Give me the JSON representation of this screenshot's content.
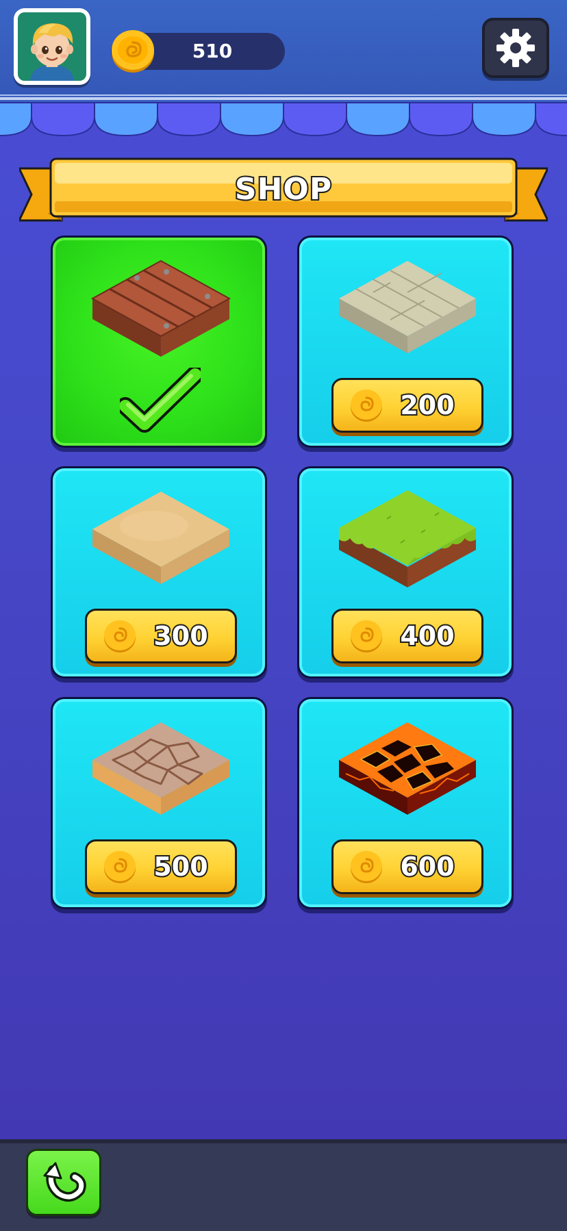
{
  "header": {
    "coins": "510",
    "avatar_icon": "boy-avatar-icon",
    "coin_icon": "gold-coin-icon",
    "settings_icon": "gear-icon"
  },
  "shop": {
    "title": "SHOP",
    "items": [
      {
        "name": "wood-tile",
        "status": "selected",
        "price": null
      },
      {
        "name": "stone-brick-tile",
        "price": "200"
      },
      {
        "name": "sand-tile",
        "price": "300"
      },
      {
        "name": "grass-tile",
        "price": "400"
      },
      {
        "name": "cracked-stone-tile",
        "price": "500"
      },
      {
        "name": "lava-tile",
        "price": "600"
      }
    ]
  },
  "footer": {
    "back_icon": "back-arrow-icon"
  },
  "colors": {
    "card_available": "#1fe6f5",
    "card_selected": "#2ee11a",
    "price_button": "#ffd233",
    "title_ribbon": "#ffd54a"
  }
}
